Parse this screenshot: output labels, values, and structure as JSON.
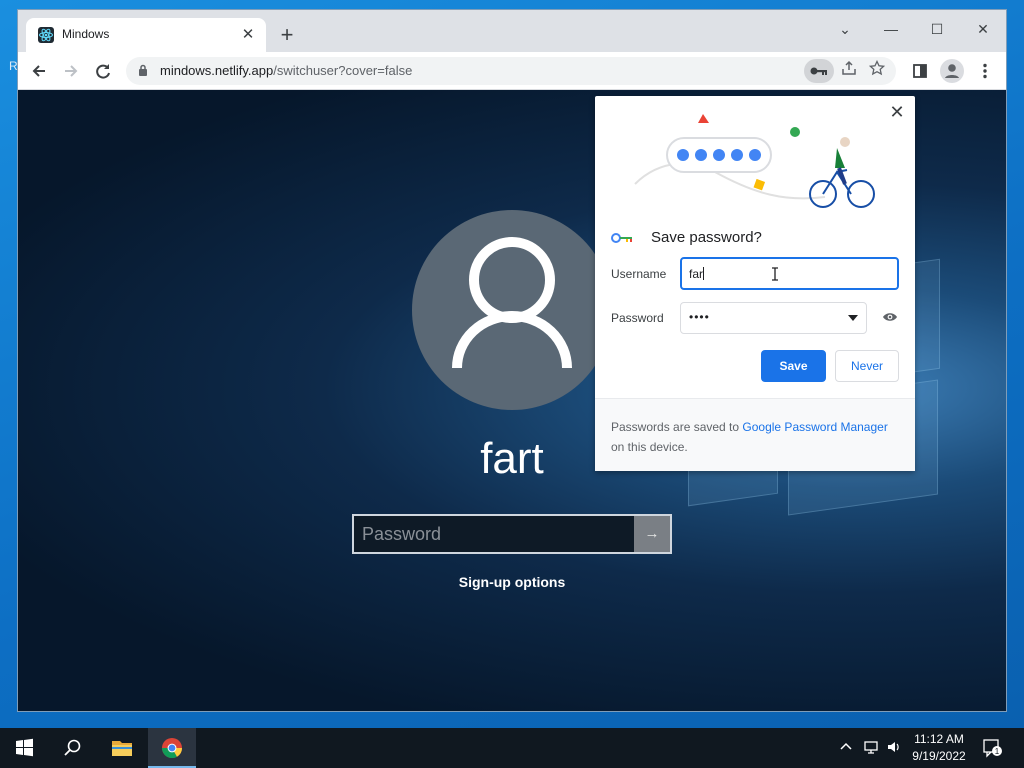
{
  "desktop": {
    "glyph_r": "R"
  },
  "browser": {
    "tab": {
      "title": "Mindows",
      "close": "✕"
    },
    "new_tab": "+",
    "window_controls": {
      "dropdown": "⌄",
      "minimize": "—",
      "maximize": "☐",
      "close": "✕"
    },
    "toolbar": {
      "url_host": "mindows.netlify.app",
      "url_path": "/switchuser?cover=false"
    }
  },
  "lockscreen": {
    "user_name": "fart",
    "password_placeholder": "Password",
    "submit": "→",
    "signup": "Sign-up options"
  },
  "save_password_dialog": {
    "title": "Save password?",
    "close": "✕",
    "username_label": "Username",
    "username_value": "far",
    "password_label": "Password",
    "password_value": "••••",
    "save_button": "Save",
    "never_button": "Never",
    "footer_prefix": "Passwords are saved to ",
    "footer_link": "Google Password Manager",
    "footer_suffix": " on this device."
  },
  "taskbar": {
    "time": "11:12 AM",
    "date": "9/19/2022",
    "notification_count": "1"
  },
  "colors": {
    "accent_blue": "#1a73e8",
    "desktop_blue": "#0d6fc4",
    "taskbar": "#101820"
  },
  "icons": [
    "react-icon",
    "lock-icon",
    "key-icon",
    "share-icon",
    "star-icon",
    "sidepanel-icon",
    "profile-icon",
    "menu-icon",
    "eye-icon",
    "windows-start-icon",
    "search-icon",
    "folder-icon",
    "chrome-icon"
  ]
}
